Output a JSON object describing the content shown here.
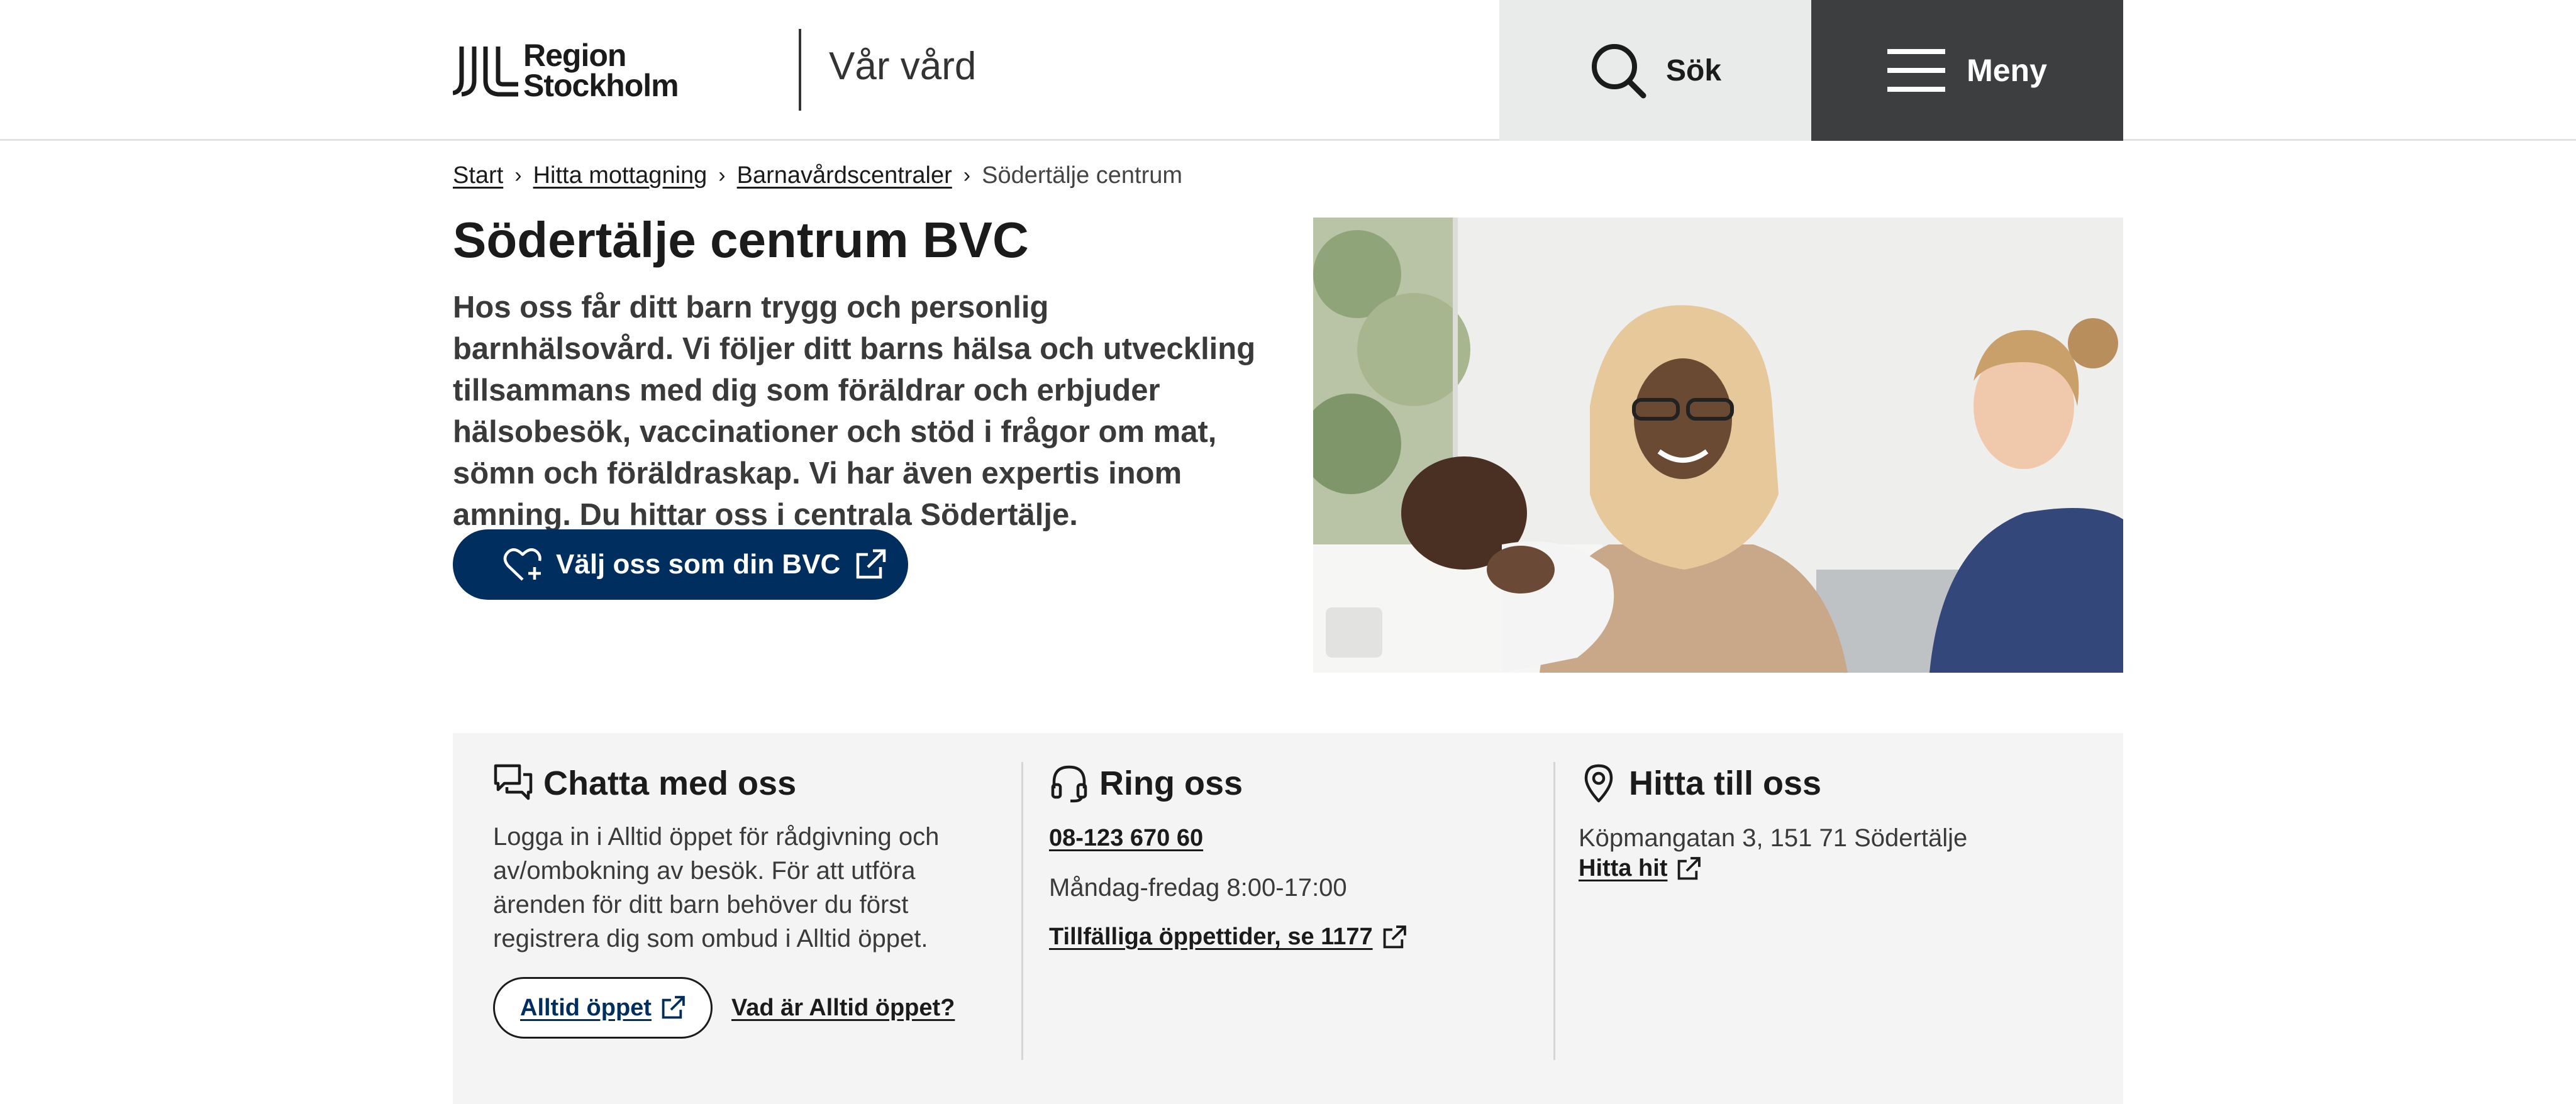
{
  "header": {
    "logo_line1": "Region",
    "logo_line2": "Stockholm",
    "site_title": "Vår vård",
    "search_label": "Sök",
    "menu_label": "Meny"
  },
  "breadcrumb": {
    "items": [
      "Start",
      "Hitta mottagning",
      "Barnavårdscentraler"
    ],
    "current": "Södertälje centrum"
  },
  "hero": {
    "title": "Södertälje centrum BVC",
    "lead": "Hos oss får ditt barn trygg och personlig barnhälsovård. Vi följer ditt barns hälsa och utveckling tillsammans med dig som föräldrar och erbjuder hälsobesök, vaccinationer och stöd i frågor om mat, sömn och föräldraskap. Vi har även expertis inom amning. Du hittar oss i centrala Södertälje.",
    "cta_label": "Välj oss som din BVC"
  },
  "contact": {
    "chat": {
      "title": "Chatta med oss",
      "text": "Logga in i Alltid öppet för rådgivning och av/ombokning av besök. För att utföra ärenden för ditt barn behöver du först registrera dig som ombud i Alltid öppet.",
      "button_label": "Alltid öppet",
      "link_label": "Vad är Alltid öppet?"
    },
    "call": {
      "title": "Ring oss",
      "phone": "08-123 670 60",
      "hours": "Måndag-fredag 8:00-17:00",
      "link_label": "Tillfälliga öppettider, se 1177"
    },
    "find": {
      "title": "Hitta till oss",
      "address": "Köpmangatan 3, 151 71 Södertälje",
      "link_label": "Hitta hit"
    }
  },
  "colors": {
    "primary": "#002e5f",
    "menu_bg": "#3c3e40",
    "search_bg": "#e9eaea",
    "panel_bg": "#f4f4f4"
  }
}
